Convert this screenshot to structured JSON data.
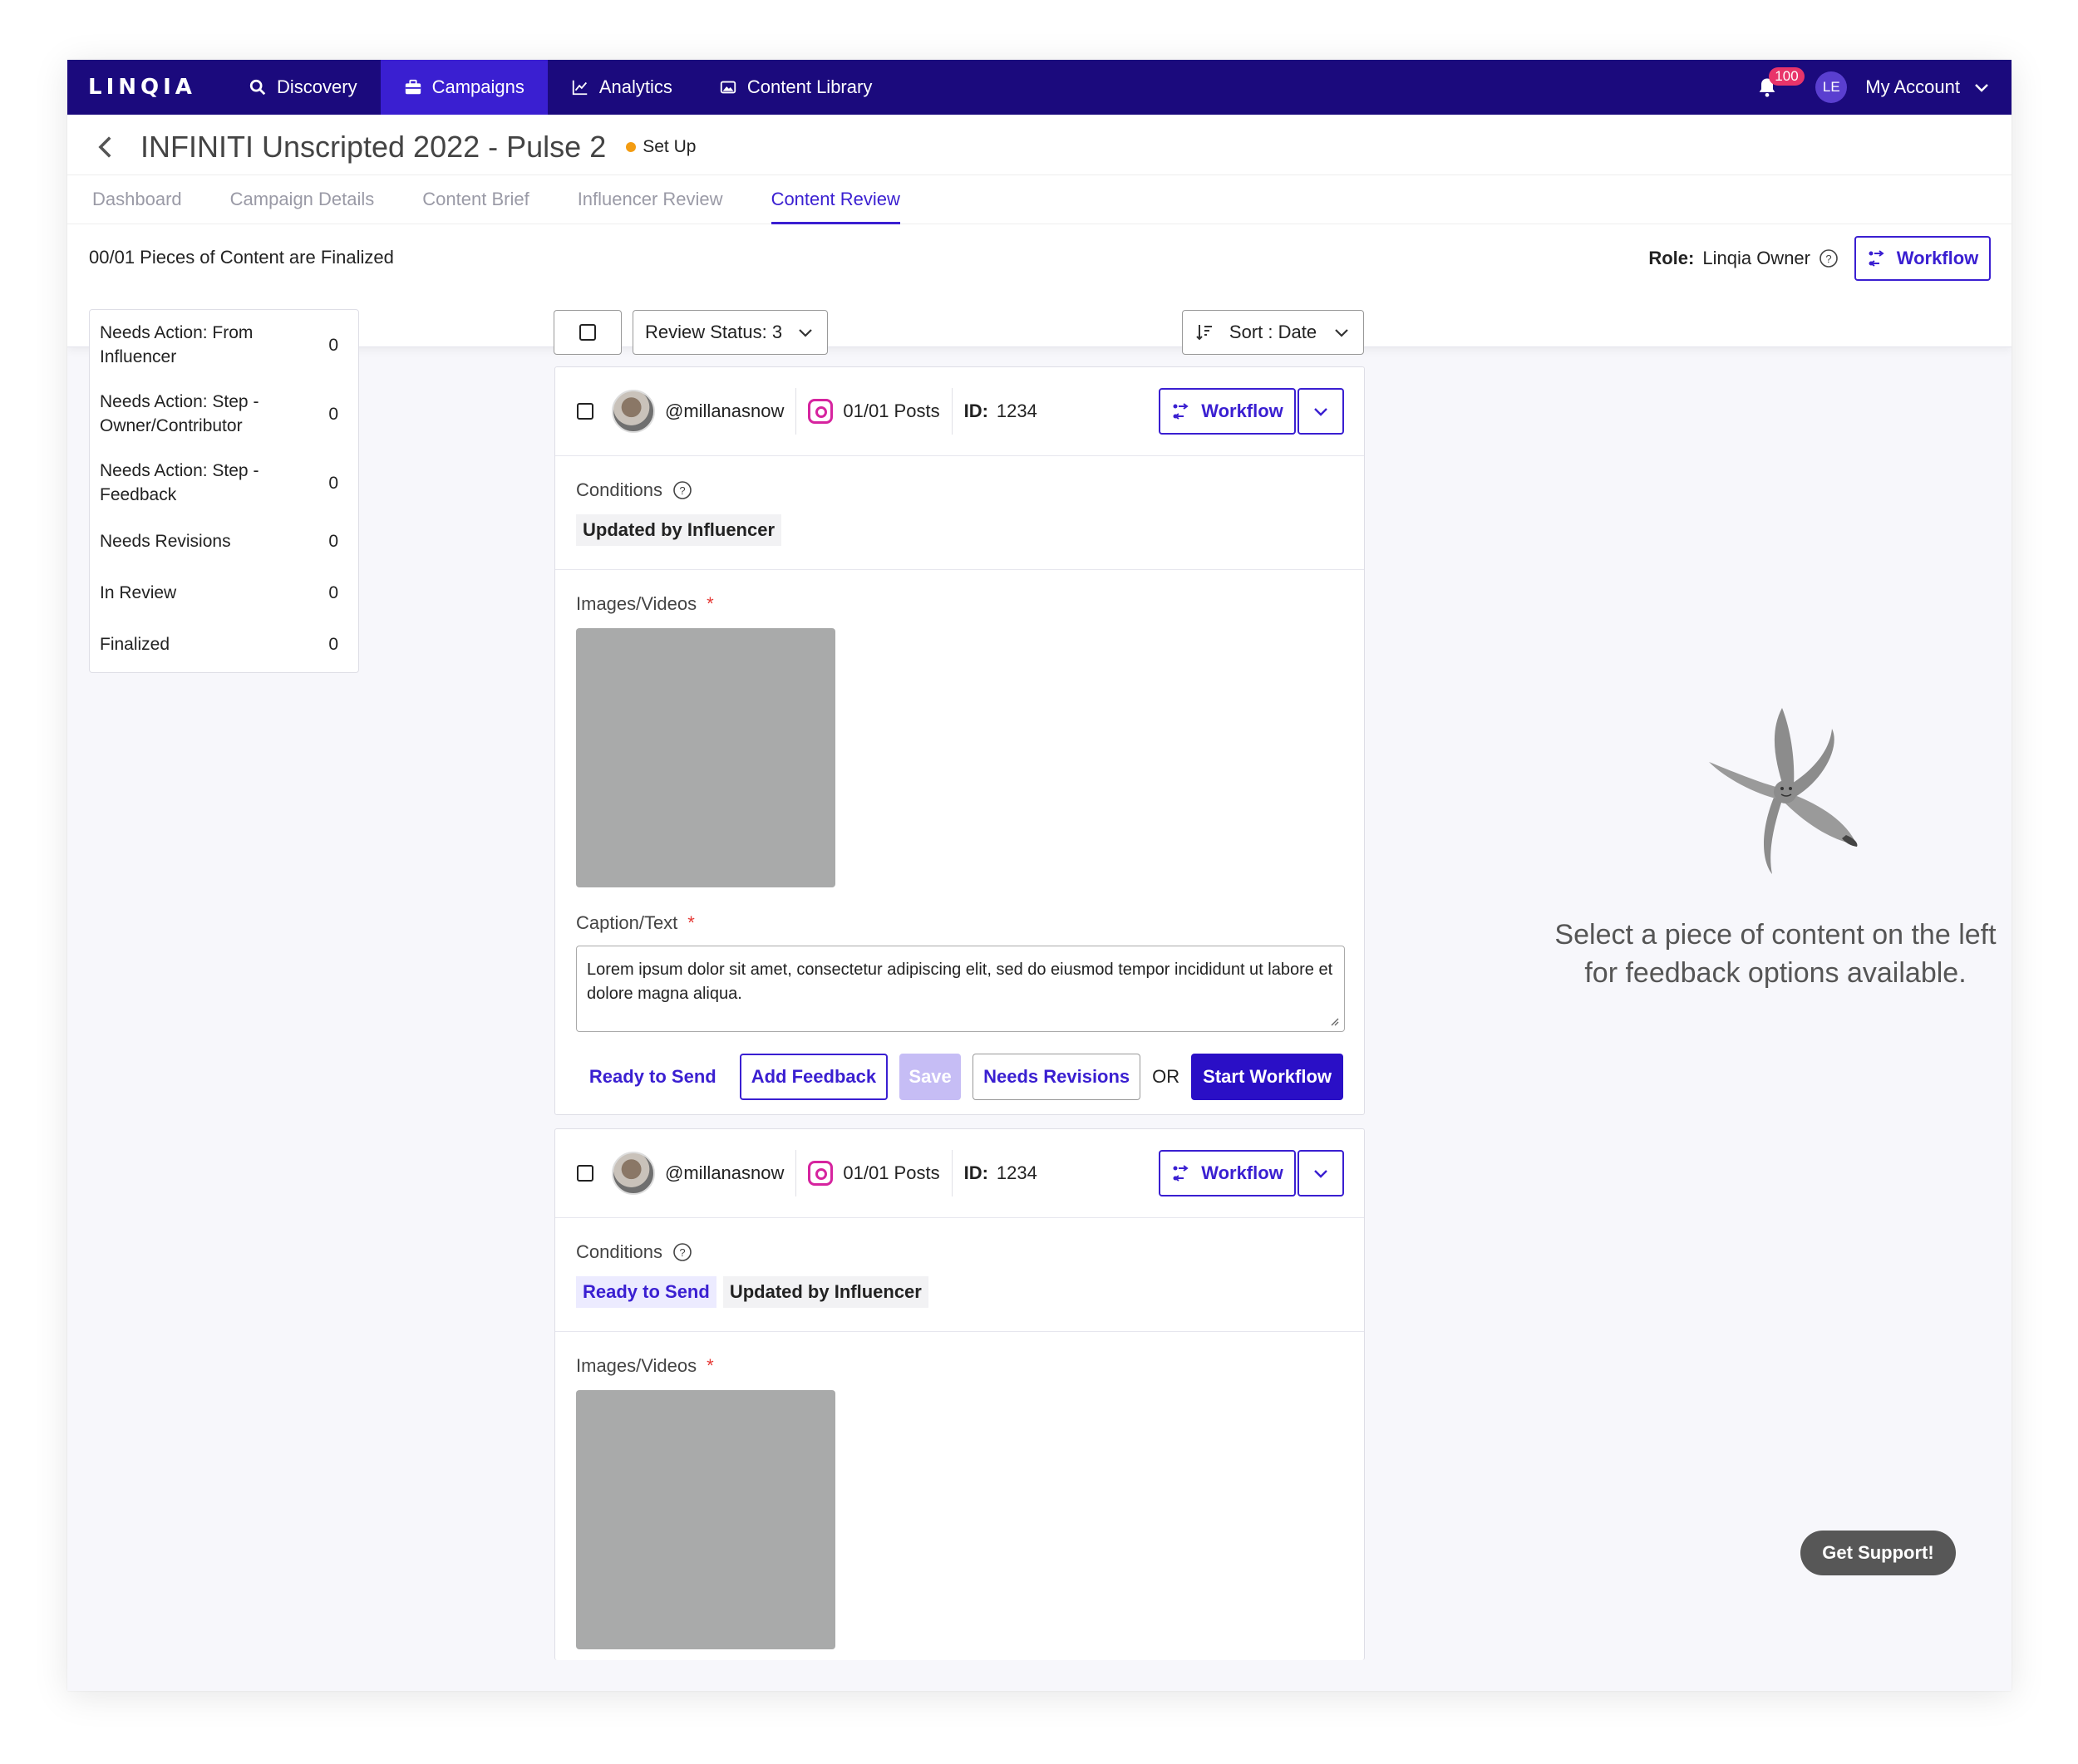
{
  "topnav": {
    "logo": "LINQIA",
    "items": [
      {
        "label": "Discovery",
        "active": false
      },
      {
        "label": "Campaigns",
        "active": true
      },
      {
        "label": "Analytics",
        "active": false
      },
      {
        "label": "Content Library",
        "active": false
      }
    ],
    "notification_count": "100",
    "user_initials": "LE",
    "account_label": "My Account"
  },
  "header": {
    "campaign_title": "INFINITI Unscripted 2022 - Pulse 2",
    "status": "Set Up",
    "tabs": [
      "Dashboard",
      "Campaign Details",
      "Content Brief",
      "Influencer Review",
      "Content Review"
    ],
    "active_tab": "Content Review",
    "finalized_text": "00/01 Pieces of Content are Finalized",
    "role_label": "Role:",
    "role_value": "Linqia Owner",
    "workflow_label": "Workflow"
  },
  "filters": [
    {
      "label": "Needs Action: From Influencer",
      "count": "0"
    },
    {
      "label": "Needs Action: Step - Owner/Contributor",
      "count": "0"
    },
    {
      "label": "Needs Action: Step - Feedback",
      "count": "0"
    },
    {
      "label": "Needs Revisions",
      "count": "0"
    },
    {
      "label": "In Review",
      "count": "0"
    },
    {
      "label": "Finalized",
      "count": "0"
    }
  ],
  "toolbar": {
    "review_status": "Review Status: 3",
    "sort": "Sort : Date"
  },
  "cards": [
    {
      "handle": "@millanasnow",
      "posts": "01/01 Posts",
      "id_label": "ID:",
      "id_value": "1234",
      "workflow_label": "Workflow",
      "conditions_label": "Conditions",
      "chips": [
        "Updated by Influencer"
      ],
      "media_label": "Images/Videos",
      "caption_label": "Caption/Text",
      "caption": "Lorem ipsum dolor sit amet, consectetur adipiscing elit, sed do eiusmod tempor incididunt ut labore et dolore magna aliqua.",
      "actions": {
        "ready": "Ready to Send",
        "add_feedback": "Add Feedback",
        "save": "Save",
        "needs_revisions": "Needs Revisions",
        "or": "OR",
        "start_workflow": "Start Workflow"
      }
    },
    {
      "handle": "@millanasnow",
      "posts": "01/01 Posts",
      "id_label": "ID:",
      "id_value": "1234",
      "workflow_label": "Workflow",
      "conditions_label": "Conditions",
      "chips": [
        "Ready to Send",
        "Updated by Influencer"
      ],
      "media_label": "Images/Videos"
    }
  ],
  "empty_state": "Select a piece of content on the left for feedback options available.",
  "support_label": "Get Support!",
  "colors": {
    "nav_bg": "#1b0a7d",
    "accent": "#3a1fd1",
    "status_dot": "#f39c12",
    "badge": "#e8346a"
  }
}
